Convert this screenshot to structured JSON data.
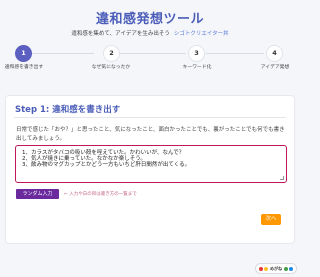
{
  "app": {
    "title": "違和感発想ツール",
    "subtitle": "違和感を集めて、アイデアを生み出そう",
    "by_label": "シゴトクリエイター丼"
  },
  "steps": [
    {
      "number": "1",
      "label": "違和感を書き出す",
      "active": true
    },
    {
      "number": "2",
      "label": "なぜ気になったか",
      "active": false
    },
    {
      "number": "3",
      "label": "キーワード化",
      "active": false
    },
    {
      "number": "4",
      "label": "アイデア発想",
      "active": false
    }
  ],
  "card": {
    "title": "Step 1: 違和感を書き出す",
    "description": "日常で感じた「おや？」と思ったこと、気になったこと、面白かったことでも、裏がったことでも何でも書き出してみましょう。",
    "input_lines": [
      "1、カラスがタバコの吸い殻を咥えていた。かわいいが、なんで？",
      "2、気人が焼きに乗っていた。なかなか楽しそう。",
      "3、飲み物のマグカップとかどう一方もいちど肝日間然が出てくる。"
    ],
    "random_button": "ランダム入力",
    "hint": "← 入力や白の目は書き方の一覧まで",
    "next_button": "次へ"
  },
  "badge": {
    "text": "めがね"
  },
  "colors": {
    "accent": "#4b5db8",
    "step_active": "#5b5fbf",
    "input_border": "#c2185b",
    "random_button": "#6a2a9e",
    "next_button": "#ff9800",
    "badge_dots": [
      "#e53935",
      "#fbc02d",
      "#43a047",
      "#1e88e5"
    ]
  }
}
